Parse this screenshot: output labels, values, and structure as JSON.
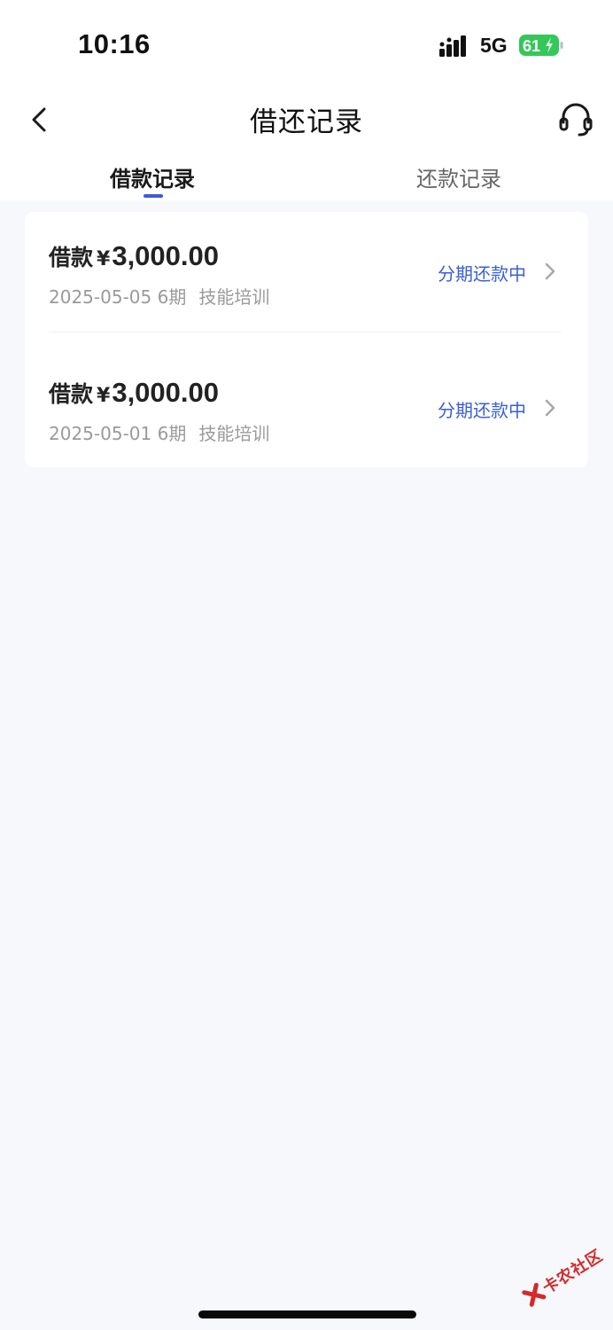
{
  "status_bar": {
    "time": "10:16",
    "network": "5G",
    "battery": "61",
    "battery_color": "#34c759"
  },
  "nav": {
    "title": "借还记录",
    "back_icon": "chevron-left-icon",
    "service_icon": "headset-icon"
  },
  "tabs": [
    {
      "label": "借款记录",
      "active": true
    },
    {
      "label": "还款记录",
      "active": false
    }
  ],
  "records": [
    {
      "prefix": "借款",
      "currency": "¥",
      "amount": "3,000.00",
      "date": "2025-05-05",
      "periods": "6期",
      "purpose": "技能培训",
      "status": "分期还款中"
    },
    {
      "prefix": "借款",
      "currency": "¥",
      "amount": "3,000.00",
      "date": "2025-05-01",
      "periods": "6期",
      "purpose": "技能培训",
      "status": "分期还款中"
    }
  ],
  "watermark": {
    "text": "卡农社区"
  },
  "colors": {
    "accent": "#3b5bdb",
    "status_text": "#3a5fd6",
    "background": "#f7f8fc"
  }
}
